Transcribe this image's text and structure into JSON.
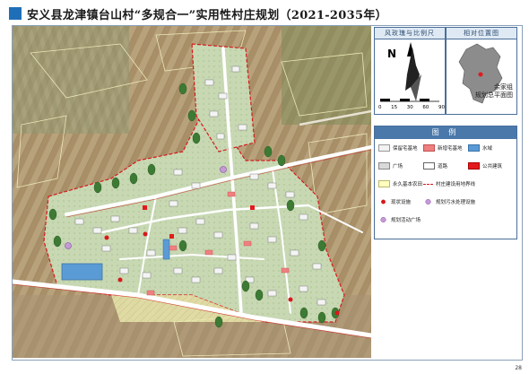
{
  "title": "安义县龙津镇台山村“多规合一”实用性村庄规划（2021-2035年）",
  "page_number": "28",
  "compass_panel": {
    "heading": "风玫瑰与比例尺",
    "north": "N",
    "scale_ticks": [
      "0",
      "15",
      "30",
      "60",
      "90"
    ],
    "scale_unit": "米"
  },
  "location_panel": {
    "heading": "相对位置图",
    "label_lines": [
      "余家组",
      "规划总平面图"
    ]
  },
  "legend": {
    "heading": "图 例",
    "items": [
      {
        "id": "preserve-house",
        "label": "保留宅基地",
        "swatch": "#f2f2f2",
        "border": "#999",
        "glyph": "⌂"
      },
      {
        "id": "new-house",
        "label": "新增宅基地",
        "swatch": "#f08080",
        "border": "#c05050",
        "glyph": ""
      },
      {
        "id": "water",
        "label": "水域",
        "swatch": "#5b9bd5",
        "border": "#3a73a8",
        "glyph": ""
      },
      {
        "id": "square",
        "label": "广场",
        "swatch": "#d9d9d9",
        "border": "#888",
        "glyph": ""
      },
      {
        "id": "road",
        "label": "道路",
        "swatch": "#ffffff",
        "border": "#666",
        "glyph": ""
      },
      {
        "id": "public-building",
        "label": "公共建筑",
        "swatch": "#e31a1c",
        "border": "#a00",
        "glyph": ""
      },
      {
        "id": "farmland",
        "label": "永久基本农田",
        "swatch": "#ffffbf",
        "border": "#bdb76b",
        "glyph": ""
      },
      {
        "id": "boundary",
        "label": "村庄建设用地界线",
        "swatch": "line",
        "border": "#d7191c",
        "glyph": ""
      },
      {
        "id": "existing-facility",
        "label": "现状设施",
        "swatch": "dot-red",
        "border": "",
        "glyph": ""
      },
      {
        "id": "sewage-facility",
        "label": "规划污水处理设施",
        "swatch": "dot-purple",
        "border": "",
        "glyph": ""
      },
      {
        "id": "planned-square",
        "label": "规划活动广场",
        "swatch": "dot-purple2",
        "border": "",
        "glyph": ""
      }
    ]
  },
  "colors": {
    "accent": "#1f6fb8",
    "boundary": "#d7191c",
    "water": "#5b9bd5"
  }
}
